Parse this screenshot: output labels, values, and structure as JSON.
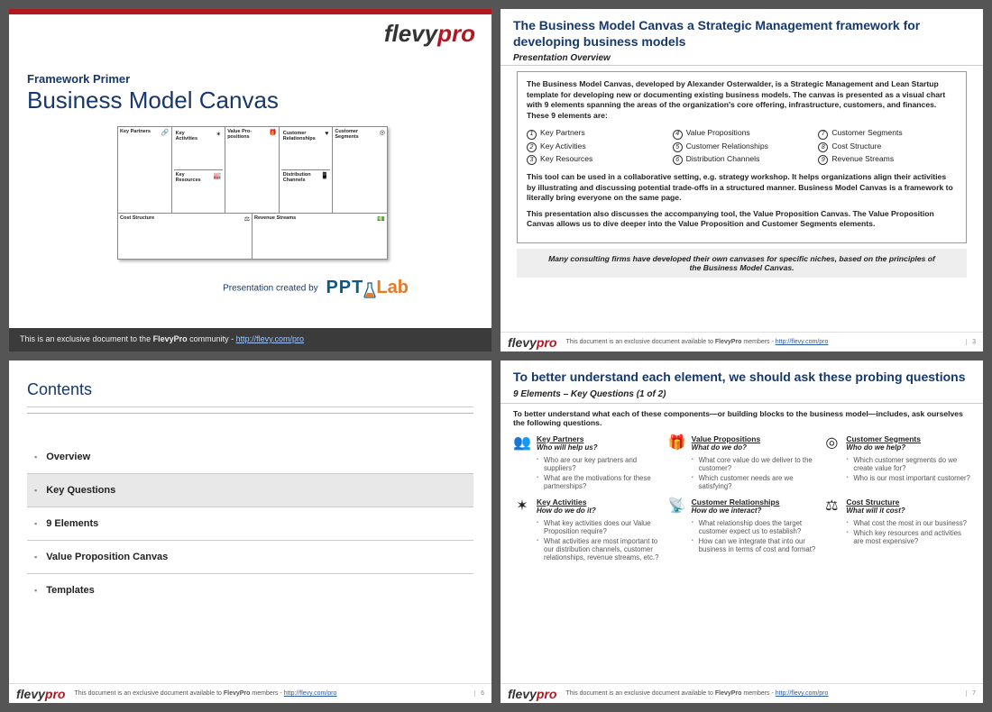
{
  "brand": {
    "flevy": "flevy",
    "pro": "pro"
  },
  "slide1": {
    "primer": "Framework Primer",
    "title": "Business Model Canvas",
    "canvas": {
      "kp": "Key Partners",
      "ka": "Key Activities",
      "kr": "Key Resources",
      "vp": "Value Pro-positions",
      "cr": "Customer Relationships",
      "dc": "Distribution Channels",
      "cs": "Customer Segments",
      "cost": "Cost Structure",
      "rev": "Revenue Streams"
    },
    "created_by": "Presentation created by",
    "pptlab": {
      "ppt": "PPT",
      "lab": "Lab"
    },
    "footer_pre": "This is an exclusive document to the ",
    "footer_bold": "FlevyPro",
    "footer_mid": " community - ",
    "footer_link": "http://flevy.com/pro"
  },
  "slide2": {
    "title": "The Business Model Canvas a Strategic Management framework for developing business models",
    "subtitle": "Presentation Overview",
    "p1": "The Business Model Canvas, developed by Alexander Osterwalder, is a Strategic Management and Lean Startup template for developing new or documenting existing business models.  The canvas is presented as a visual chart with 9 elements spanning the areas of the organization's core offering, infrastructure, customers, and finances.   These 9 elements are:",
    "elements": {
      "1": "Key Partners",
      "2": "Key Activities",
      "3": "Key Resources",
      "4": "Value Propositions",
      "5": "Customer Relationships",
      "6": "Distribution Channels",
      "7": "Customer Segments",
      "8": "Cost Structure",
      "9": "Revenue Streams"
    },
    "p2": "This tool can be used in a collaborative setting, e.g. strategy workshop.   It helps organizations align their activities by illustrating and discussing potential trade-offs in a structured manner.  Business Model Canvas is a framework to literally bring everyone on the same page.",
    "p3": "This presentation also discusses the accompanying tool, the Value Proposition Canvas.  The Value Proposition Canvas allows us to dive deeper into the Value Proposition and Customer Segments elements.",
    "quote": "Many consulting firms have developed their own canvases for specific niches, based on the principles of the Business Model Canvas.",
    "page": "3"
  },
  "slide3": {
    "title": "Contents",
    "items": [
      "Overview",
      "Key Questions",
      "9 Elements",
      "Value Proposition Canvas",
      "Templates"
    ],
    "selected_index": 1,
    "page": "6"
  },
  "slide4": {
    "title": "To better understand each element, we should ask these probing questions",
    "subtitle": "9 Elements – Key Questions  (1 of 2)",
    "intro": "To better understand what each of these components—or building blocks to the business model—includes, ask ourselves the following questions.",
    "cells": [
      {
        "icon": "👥",
        "title": "Key Partners",
        "q": "Who will help us?",
        "bullets": [
          "Who are our key partners and suppliers?",
          "What are the motivations for these partnerships?"
        ]
      },
      {
        "icon": "🎁",
        "title": "Value Propositions",
        "q": "What do we do?",
        "bullets": [
          "What core value do we deliver to the customer?",
          "Which customer needs are we satisfying?"
        ]
      },
      {
        "icon": "◎",
        "title": "Customer Segments",
        "q": "Who do we help?",
        "bullets": [
          "Which customer segments do we create value for?",
          "Who is our most important customer?"
        ]
      },
      {
        "icon": "✶",
        "title": "Key Activities",
        "q": "How do we do it?",
        "bullets": [
          "What key activities does our Value Proposition require?",
          "What activities are most important to our distribution channels, customer relationships, revenue streams, etc.?"
        ]
      },
      {
        "icon": "📡",
        "title": "Customer Relationships",
        "q": "How do we interact?",
        "bullets": [
          "What relationship does the target customer expect us to establish?",
          "How can we integrate that into our business in terms of cost and format?"
        ]
      },
      {
        "icon": "⚖",
        "title": "Cost Structure",
        "q": "What will it cost?",
        "bullets": [
          "What cost the most in our business?",
          "Which key resources and activities are most expensive?"
        ]
      }
    ],
    "page": "7"
  },
  "shared_footer": {
    "text_pre": "This document is an exclusive document available to ",
    "text_bold": "FlevyPro",
    "text_mid": " members - ",
    "link": "http://flevy.com/pro"
  }
}
